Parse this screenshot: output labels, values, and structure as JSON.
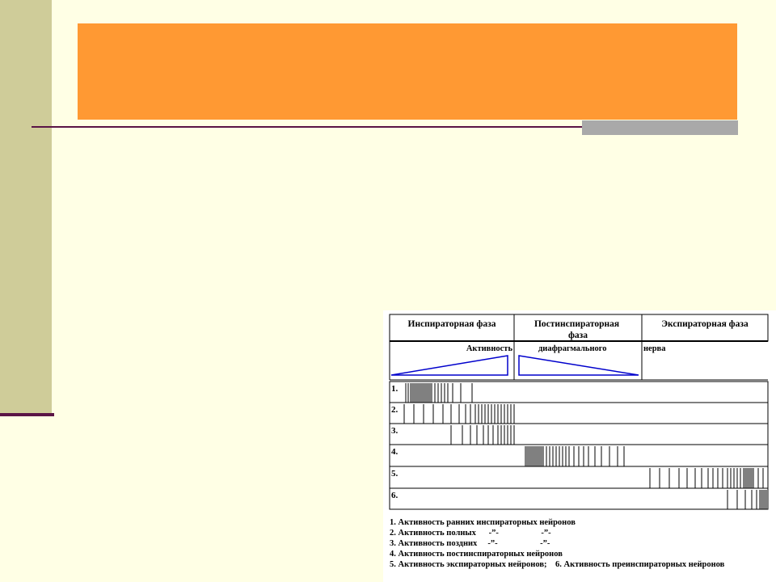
{
  "theme": {
    "background": "#FFFFE5",
    "sidebar": "#CFCC99",
    "title_bar": "#FF9933",
    "rule": "#5A1446",
    "accent": "#A9A9A9",
    "wave": "#0000CC"
  },
  "title": "",
  "diagram": {
    "headers": [
      "Инспираторная фаза",
      "Постинспираторная фаза",
      "Экспираторная фаза"
    ],
    "activity_label": [
      "Активность",
      "диафрагмального",
      "нерва"
    ],
    "rows": [
      {
        "label": "1."
      },
      {
        "label": "2."
      },
      {
        "label": "3."
      },
      {
        "label": "4."
      },
      {
        "label": "5."
      },
      {
        "label": "6."
      }
    ],
    "legend": [
      "1. Активность ранних инспираторных нейронов",
      "2. Активность полных      -”-                    -”-",
      "3. Активность поздних     -”-                    -”-",
      "4. Активность постинспираторных нейронов",
      "5. Активность экспираторных нейронов;    6. Активность преинспираторных нейронов"
    ]
  }
}
